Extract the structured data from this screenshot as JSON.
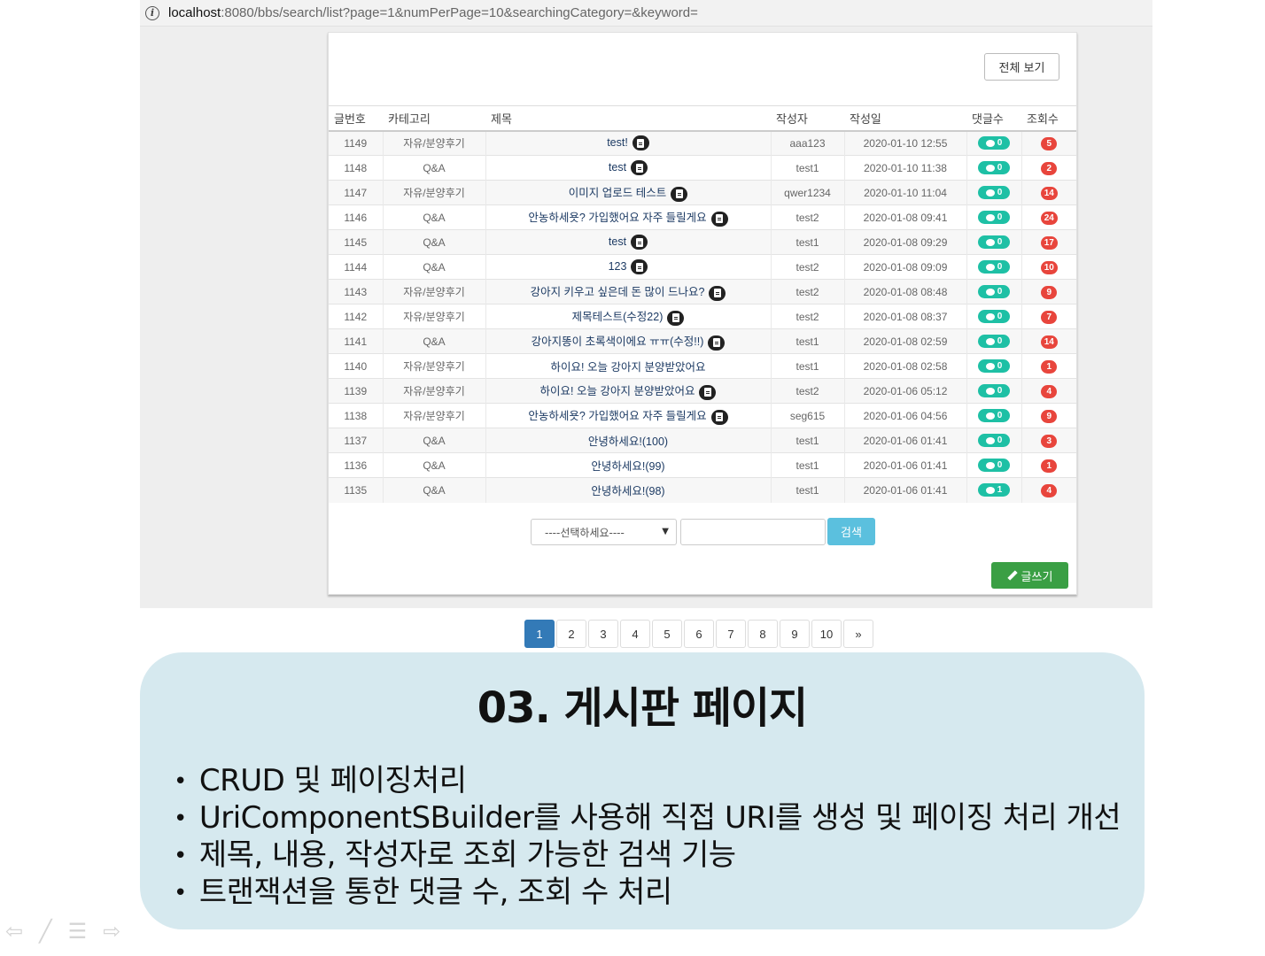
{
  "url": {
    "host": "localhost",
    "path": ":8080/bbs/search/list?page=1&numPerPage=10&searchingCategory=&keyword="
  },
  "board": {
    "view_all_label": "전체 보기",
    "columns": [
      "글번호",
      "카테고리",
      "제목",
      "작성자",
      "작성일",
      "댓글수",
      "조회수"
    ],
    "rows": [
      {
        "no": "1149",
        "cat": "자유/분양후기",
        "title": "test!",
        "doc": true,
        "author": "aaa123",
        "date": "2020-01-10 12:55",
        "comments": "0",
        "views": "5"
      },
      {
        "no": "1148",
        "cat": "Q&A",
        "title": "test",
        "doc": true,
        "author": "test1",
        "date": "2020-01-10 11:38",
        "comments": "0",
        "views": "2"
      },
      {
        "no": "1147",
        "cat": "자유/분양후기",
        "title": "이미지 업로드 테스트",
        "doc": true,
        "author": "qwer1234",
        "date": "2020-01-10 11:04",
        "comments": "0",
        "views": "14"
      },
      {
        "no": "1146",
        "cat": "Q&A",
        "title": "안농하세욧? 가입했어요 자주 들릴게요",
        "doc": true,
        "author": "test2",
        "date": "2020-01-08 09:41",
        "comments": "0",
        "views": "24"
      },
      {
        "no": "1145",
        "cat": "Q&A",
        "title": "test",
        "doc": true,
        "author": "test1",
        "date": "2020-01-08 09:29",
        "comments": "0",
        "views": "17"
      },
      {
        "no": "1144",
        "cat": "Q&A",
        "title": "123",
        "doc": true,
        "author": "test2",
        "date": "2020-01-08 09:09",
        "comments": "0",
        "views": "10"
      },
      {
        "no": "1143",
        "cat": "자유/분양후기",
        "title": "강아지 키우고 싶은데 돈 많이 드나요?",
        "doc": true,
        "author": "test2",
        "date": "2020-01-08 08:48",
        "comments": "0",
        "views": "9"
      },
      {
        "no": "1142",
        "cat": "자유/분양후기",
        "title": "제목테스트(수정22)",
        "doc": true,
        "author": "test2",
        "date": "2020-01-08 08:37",
        "comments": "0",
        "views": "7"
      },
      {
        "no": "1141",
        "cat": "Q&A",
        "title": "강아지똥이 초록색이에요 ㅠㅠ(수정!!)",
        "doc": true,
        "author": "test1",
        "date": "2020-01-08 02:59",
        "comments": "0",
        "views": "14"
      },
      {
        "no": "1140",
        "cat": "자유/분양후기",
        "title": "하이요! 오늘 강아지 분양받았어요",
        "doc": false,
        "author": "test1",
        "date": "2020-01-08 02:58",
        "comments": "0",
        "views": "1"
      },
      {
        "no": "1139",
        "cat": "자유/분양후기",
        "title": "하이요! 오늘 강아지 분양받았어요",
        "doc": true,
        "author": "test2",
        "date": "2020-01-06 05:12",
        "comments": "0",
        "views": "4"
      },
      {
        "no": "1138",
        "cat": "자유/분양후기",
        "title": "안농하세욧? 가입했어요 자주 들릴게요",
        "doc": true,
        "author": "seg615",
        "date": "2020-01-06 04:56",
        "comments": "0",
        "views": "9"
      },
      {
        "no": "1137",
        "cat": "Q&A",
        "title": "안녕하세요!(100)",
        "doc": false,
        "author": "test1",
        "date": "2020-01-06 01:41",
        "comments": "0",
        "views": "3"
      },
      {
        "no": "1136",
        "cat": "Q&A",
        "title": "안녕하세요!(99)",
        "doc": false,
        "author": "test1",
        "date": "2020-01-06 01:41",
        "comments": "0",
        "views": "1"
      },
      {
        "no": "1135",
        "cat": "Q&A",
        "title": "안녕하세요!(98)",
        "doc": false,
        "author": "test1",
        "date": "2020-01-06 01:41",
        "comments": "1",
        "views": "4"
      }
    ],
    "colors": {
      "comment_badge": "#1ec0a5",
      "view_badge": "#e8453c"
    }
  },
  "search": {
    "select_value": "----선택하세요----",
    "keyword_value": "",
    "button_label": "검색"
  },
  "write_label": "글쓰기",
  "pagination": {
    "pages": [
      "1",
      "2",
      "3",
      "4",
      "5",
      "6",
      "7",
      "8",
      "9",
      "10"
    ],
    "next": "»",
    "active": "1"
  },
  "slide": {
    "title": "03. 게시판 페이지",
    "bullets": [
      "CRUD 및 페이징처리",
      "UriComponentSBuilder를 사용해 직접 URI를 생성 및 페이징 처리 개선",
      "제목, 내용, 작성자로 조회 가능한 검색 기능",
      "트랜잭션을 통한 댓글 수, 조회 수 처리"
    ]
  }
}
